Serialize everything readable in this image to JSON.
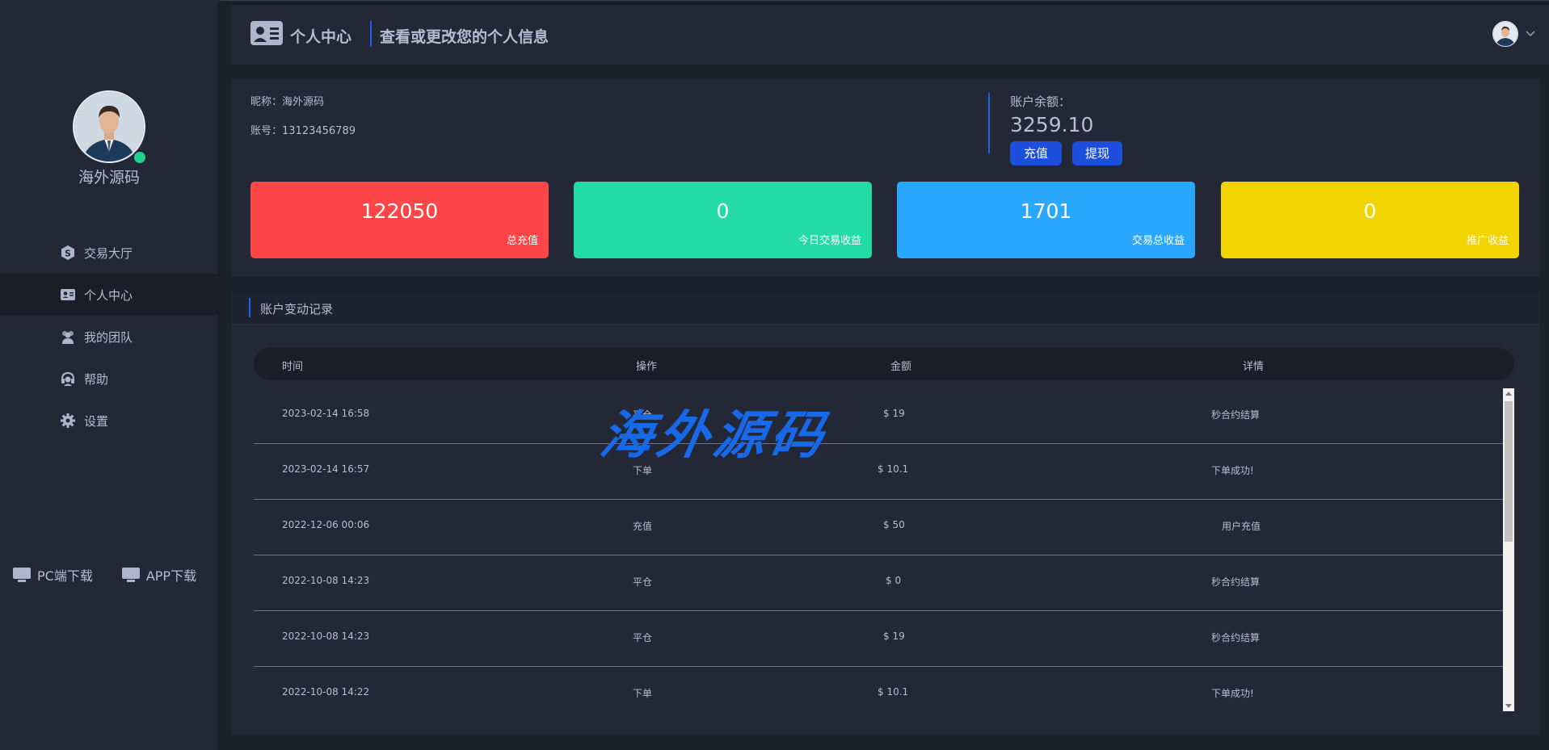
{
  "sidebar": {
    "user_name": "海外源码",
    "nav": [
      {
        "label": "交易大厅",
        "icon": "trading-hall-icon"
      },
      {
        "label": "个人中心",
        "icon": "profile-card-icon",
        "active": true
      },
      {
        "label": "我的团队",
        "icon": "team-icon"
      },
      {
        "label": "帮助",
        "icon": "headset-help-icon"
      },
      {
        "label": "设置",
        "icon": "gear-icon"
      }
    ],
    "downloads": [
      {
        "label": "PC端下载",
        "icon": "monitor-icon"
      },
      {
        "label": "APP下载",
        "icon": "monitor-icon"
      }
    ]
  },
  "header": {
    "title": "个人中心",
    "subtitle": "查看或更改您的个人信息"
  },
  "profile": {
    "nickname": "昵称：海外源码",
    "account": "账号：13123456789",
    "balance_label": "账户余额：",
    "balance": "3259.10",
    "recharge_label": "充值",
    "withdraw_label": "提现"
  },
  "stats": [
    {
      "value": "122050",
      "label": "总充值",
      "color": "#fe4648"
    },
    {
      "value": "0",
      "label": "今日交易收益",
      "color": "#23dba4"
    },
    {
      "value": "1701",
      "label": "交易总收益",
      "color": "#2aa7ff"
    },
    {
      "value": "0",
      "label": "推广收益",
      "color": "#f2d400"
    }
  ],
  "records": {
    "title": "账户变动记录",
    "columns": [
      "时间",
      "操作",
      "金额",
      "详情"
    ],
    "rows": [
      {
        "time": "2023-02-14 16:58",
        "op": "平仓",
        "amount": "$ 19",
        "detail": "秒合约结算"
      },
      {
        "time": "2023-02-14 16:57",
        "op": "下单",
        "amount": "$ 10.1",
        "detail": "下单成功!"
      },
      {
        "time": "2022-12-06 00:06",
        "op": "充值",
        "amount": "$ 50",
        "detail": "用户充值"
      },
      {
        "time": "2022-10-08 14:23",
        "op": "平仓",
        "amount": "$ 0",
        "detail": "秒合约结算"
      },
      {
        "time": "2022-10-08 14:23",
        "op": "平仓",
        "amount": "$ 19",
        "detail": "秒合约结算"
      },
      {
        "time": "2022-10-08 14:22",
        "op": "下单",
        "amount": "$ 10.1",
        "detail": "下单成功!"
      }
    ]
  },
  "watermark": "海外源码"
}
